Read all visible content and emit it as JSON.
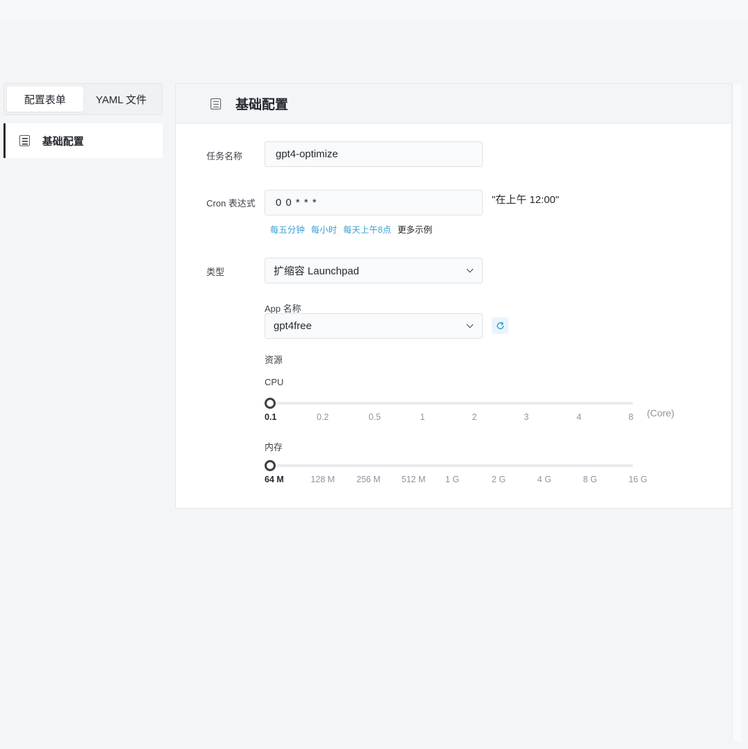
{
  "tabs": [
    {
      "label": "配置表单",
      "active": true
    },
    {
      "label": "YAML 文件",
      "active": false
    }
  ],
  "sidebar": {
    "items": [
      {
        "label": "基础配置",
        "icon": "document-icon"
      }
    ]
  },
  "card": {
    "title": "基础配置",
    "icon": "document-icon"
  },
  "form": {
    "task_name": {
      "label": "任务名称",
      "value": "gpt4-optimize"
    },
    "cron": {
      "label": "Cron 表达式",
      "value": "0 0 * * *",
      "readable": "\"在上午 12:00\"",
      "examples": [
        "每五分钟",
        "每小时",
        "每天上午8点"
      ],
      "more_examples": "更多示例"
    },
    "type": {
      "label": "类型",
      "value": "扩缩容 Launchpad"
    },
    "app": {
      "label": "App 名称",
      "value": "gpt4free"
    },
    "resources": {
      "label": "资源",
      "cpu": {
        "label": "CPU",
        "ticks": [
          "0.1",
          "0.2",
          "0.5",
          "1",
          "2",
          "3",
          "4",
          "8"
        ],
        "selected": "0.1",
        "unit": "(Core)"
      },
      "memory": {
        "label": "内存",
        "ticks": [
          "64 M",
          "128 M",
          "256 M",
          "512 M",
          "1 G",
          "2 G",
          "4 G",
          "8 G",
          "16 G"
        ],
        "selected": "64 M"
      }
    }
  },
  "colors": {
    "link": "#3c9fd6",
    "accent_border": "#24282e",
    "background": "#f4f5f7"
  }
}
